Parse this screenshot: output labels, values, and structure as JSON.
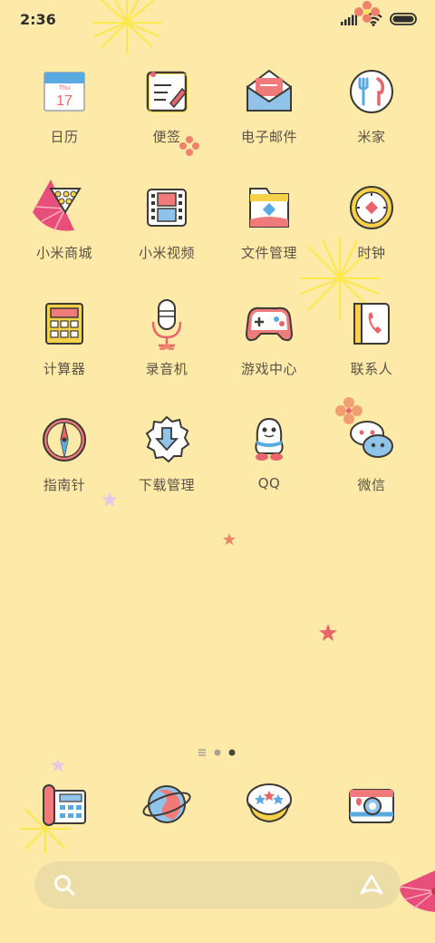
{
  "status": {
    "time": "2:36",
    "icons": [
      "signal-icon",
      "wifi-icon",
      "battery-icon"
    ]
  },
  "apps": [
    {
      "label": "日历",
      "icon": "calendar-icon",
      "sub_day": "Thu",
      "sub_date": "17"
    },
    {
      "label": "便签",
      "icon": "notes-icon"
    },
    {
      "label": "电子邮件",
      "icon": "email-icon"
    },
    {
      "label": "米家",
      "icon": "mijia-icon"
    },
    {
      "label": "小米商城",
      "icon": "mi-store-icon"
    },
    {
      "label": "小米视频",
      "icon": "video-icon"
    },
    {
      "label": "文件管理",
      "icon": "file-manager-icon"
    },
    {
      "label": "时钟",
      "icon": "clock-icon"
    },
    {
      "label": "计算器",
      "icon": "calculator-icon"
    },
    {
      "label": "录音机",
      "icon": "recorder-icon"
    },
    {
      "label": "游戏中心",
      "icon": "game-center-icon"
    },
    {
      "label": "联系人",
      "icon": "contacts-icon"
    },
    {
      "label": "指南针",
      "icon": "compass-icon"
    },
    {
      "label": "下载管理",
      "icon": "download-icon"
    },
    {
      "label": "QQ",
      "icon": "qq-icon"
    },
    {
      "label": "微信",
      "icon": "wechat-icon"
    }
  ],
  "dock": [
    "phone-icon",
    "browser-icon",
    "messages-icon",
    "camera-icon"
  ],
  "page_indicator": {
    "pages": 3,
    "current": 3
  },
  "search": {
    "left_icon": "search-icon",
    "right_icon": "assistant-icon"
  },
  "colors": {
    "background": "#fde9a8",
    "label": "#5b5347",
    "accent_red": "#e8666b",
    "accent_blue": "#5aa9e0"
  }
}
